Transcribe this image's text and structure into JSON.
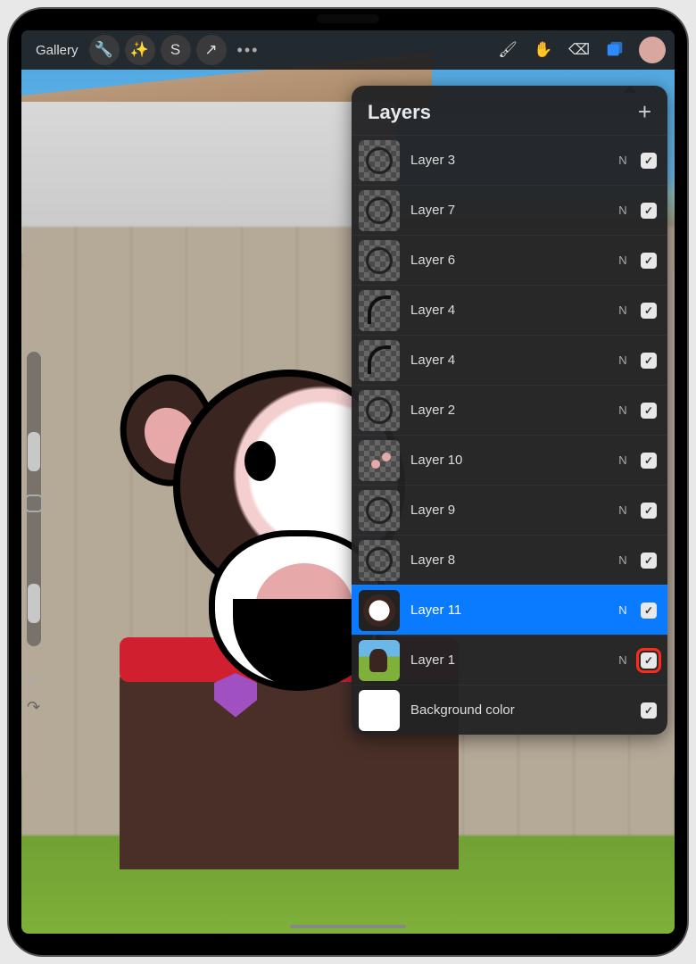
{
  "toolbar": {
    "gallery_label": "Gallery"
  },
  "panel": {
    "title": "Layers"
  },
  "layers": [
    {
      "name": "Layer 3",
      "blend": "N"
    },
    {
      "name": "Layer 7",
      "blend": "N"
    },
    {
      "name": "Layer 6",
      "blend": "N"
    },
    {
      "name": "Layer 4",
      "blend": "N"
    },
    {
      "name": "Layer 4",
      "blend": "N"
    },
    {
      "name": "Layer 2",
      "blend": "N"
    },
    {
      "name": "Layer 10",
      "blend": "N"
    },
    {
      "name": "Layer 9",
      "blend": "N"
    },
    {
      "name": "Layer 8",
      "blend": "N"
    },
    {
      "name": "Layer 11",
      "blend": "N"
    },
    {
      "name": "Layer 1",
      "blend": "N"
    },
    {
      "name": "Background color",
      "blend": ""
    }
  ]
}
